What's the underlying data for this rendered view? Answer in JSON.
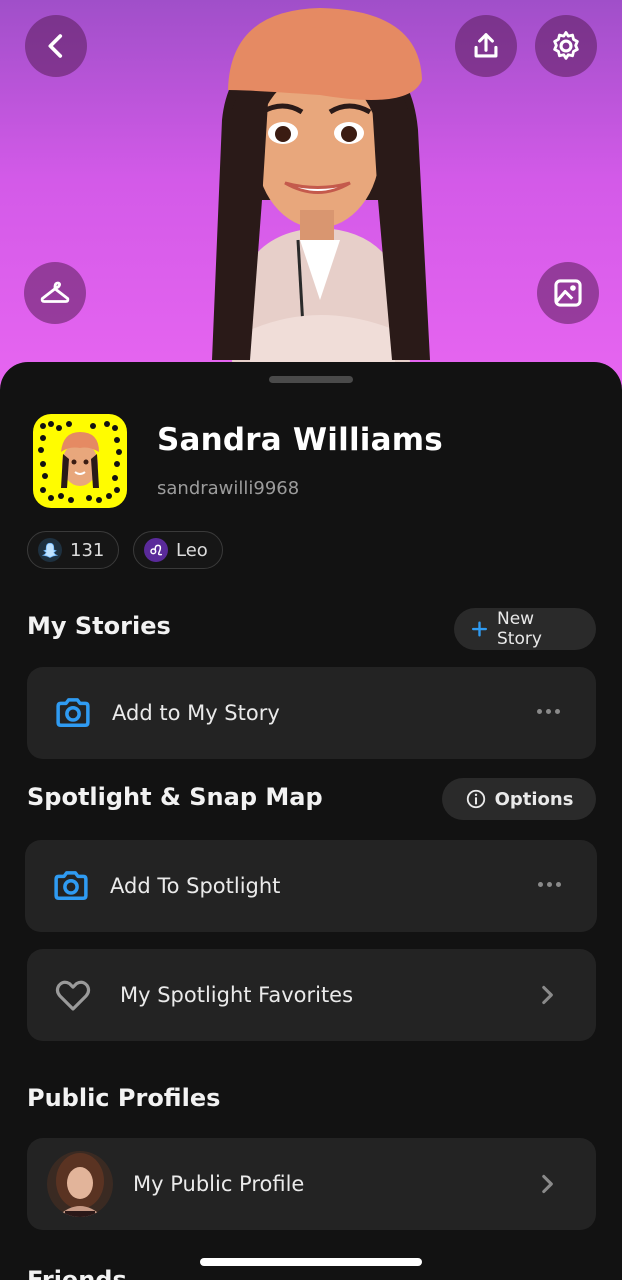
{
  "header": {
    "back_icon": "chevron-left-icon",
    "share_icon": "upload-icon",
    "settings_icon": "gear-icon",
    "outfit_icon": "hanger-icon",
    "background_icon": "image-frame-icon"
  },
  "profile": {
    "display_name": "Sandra Williams",
    "username": "sandrawilli9968",
    "snapscore": "131",
    "zodiac": "Leo"
  },
  "my_stories": {
    "title": "My Stories",
    "new_story_label": "New Story",
    "add_label": "Add to My Story"
  },
  "spotlight": {
    "title": "Spotlight & Snap Map",
    "options_label": "Options",
    "add_label": "Add To Spotlight",
    "favorites_label": "My Spotlight Favorites"
  },
  "public_profiles": {
    "title": "Public Profiles",
    "item_label": "My Public Profile"
  },
  "next_section": {
    "title": "Friends"
  },
  "colors": {
    "accent_blue": "#2f9bf2",
    "snap_yellow": "#fffc00",
    "hero_purple": "#d35ae8"
  }
}
